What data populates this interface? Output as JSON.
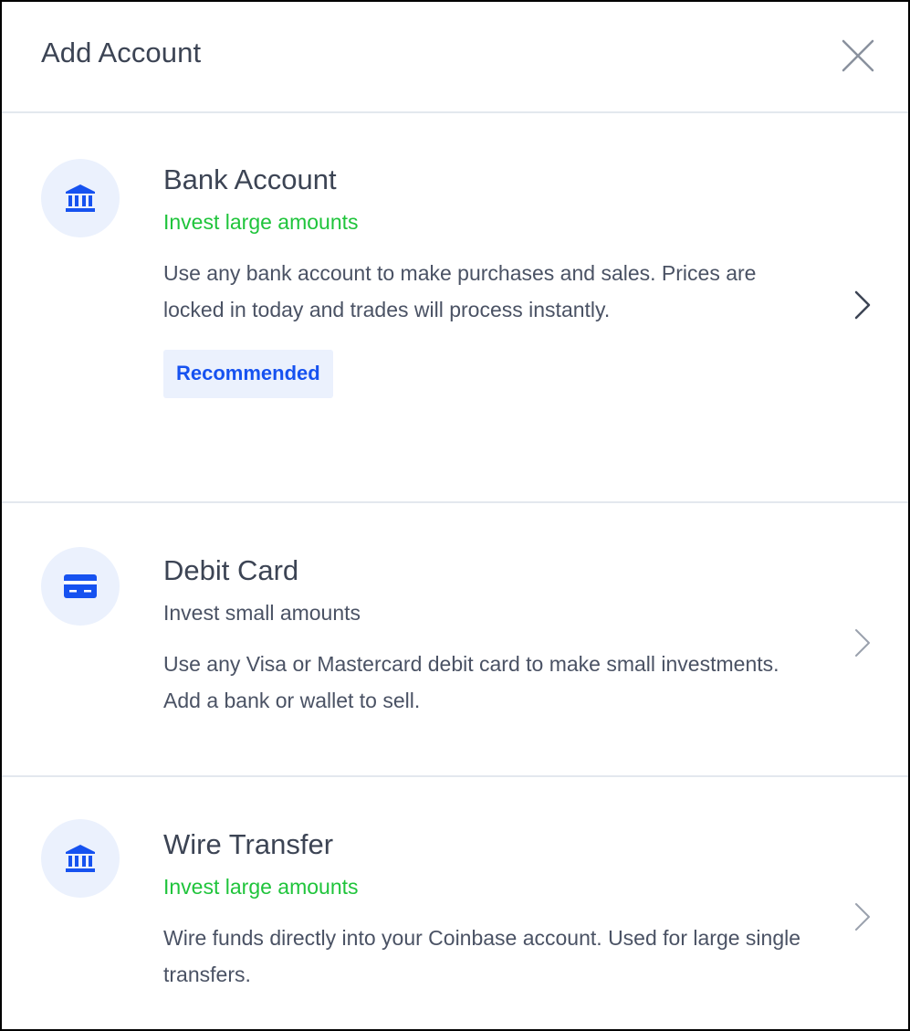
{
  "header": {
    "title": "Add Account",
    "close_icon": "close-icon"
  },
  "options": [
    {
      "icon": "bank-icon",
      "title": "Bank Account",
      "subtitle": "Invest large amounts",
      "subtitle_color": "#1fc43b",
      "description": "Use any bank account to make purchases and sales. Prices are locked in today and trades will process instantly.",
      "badge": "Recommended",
      "chevron_color": "#3c4454"
    },
    {
      "icon": "credit-card-icon",
      "title": "Debit Card",
      "subtitle": "Invest small amounts",
      "subtitle_color": "#4a5264",
      "description": "Use any Visa or Mastercard debit card to make small investments. Add a bank or wallet to sell.",
      "chevron_color": "#9aa1ad"
    },
    {
      "icon": "bank-icon",
      "title": "Wire Transfer",
      "subtitle": "Invest large amounts",
      "subtitle_color": "#1fc43b",
      "description": "Wire funds directly into your Coinbase account. Used for large single transfers.",
      "chevron_color": "#9aa1ad"
    }
  ],
  "colors": {
    "accent_blue": "#1652f0",
    "icon_bg": "#ebf1fd",
    "divider": "#e3e8ee",
    "text_dark": "#3c4454"
  }
}
